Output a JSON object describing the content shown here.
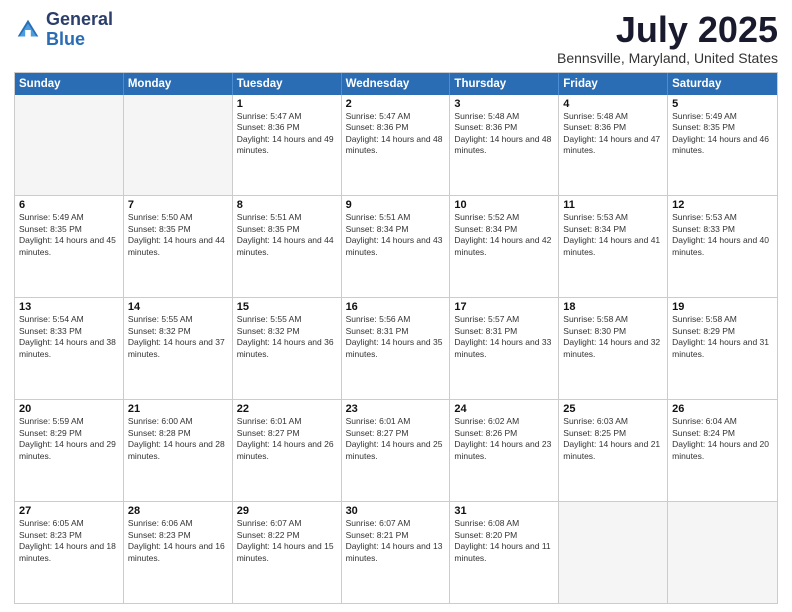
{
  "header": {
    "logo": {
      "general": "General",
      "blue": "Blue"
    },
    "title": "July 2025",
    "location": "Bennsville, Maryland, United States"
  },
  "days_of_week": [
    "Sunday",
    "Monday",
    "Tuesday",
    "Wednesday",
    "Thursday",
    "Friday",
    "Saturday"
  ],
  "weeks": [
    [
      {
        "day": null,
        "empty": true
      },
      {
        "day": null,
        "empty": true
      },
      {
        "day": "1",
        "sunrise": "5:47 AM",
        "sunset": "8:36 PM",
        "daylight": "14 hours and 49 minutes."
      },
      {
        "day": "2",
        "sunrise": "5:47 AM",
        "sunset": "8:36 PM",
        "daylight": "14 hours and 48 minutes."
      },
      {
        "day": "3",
        "sunrise": "5:48 AM",
        "sunset": "8:36 PM",
        "daylight": "14 hours and 48 minutes."
      },
      {
        "day": "4",
        "sunrise": "5:48 AM",
        "sunset": "8:36 PM",
        "daylight": "14 hours and 47 minutes."
      },
      {
        "day": "5",
        "sunrise": "5:49 AM",
        "sunset": "8:35 PM",
        "daylight": "14 hours and 46 minutes."
      }
    ],
    [
      {
        "day": "6",
        "sunrise": "5:49 AM",
        "sunset": "8:35 PM",
        "daylight": "14 hours and 45 minutes."
      },
      {
        "day": "7",
        "sunrise": "5:50 AM",
        "sunset": "8:35 PM",
        "daylight": "14 hours and 44 minutes."
      },
      {
        "day": "8",
        "sunrise": "5:51 AM",
        "sunset": "8:35 PM",
        "daylight": "14 hours and 44 minutes."
      },
      {
        "day": "9",
        "sunrise": "5:51 AM",
        "sunset": "8:34 PM",
        "daylight": "14 hours and 43 minutes."
      },
      {
        "day": "10",
        "sunrise": "5:52 AM",
        "sunset": "8:34 PM",
        "daylight": "14 hours and 42 minutes."
      },
      {
        "day": "11",
        "sunrise": "5:53 AM",
        "sunset": "8:34 PM",
        "daylight": "14 hours and 41 minutes."
      },
      {
        "day": "12",
        "sunrise": "5:53 AM",
        "sunset": "8:33 PM",
        "daylight": "14 hours and 40 minutes."
      }
    ],
    [
      {
        "day": "13",
        "sunrise": "5:54 AM",
        "sunset": "8:33 PM",
        "daylight": "14 hours and 38 minutes."
      },
      {
        "day": "14",
        "sunrise": "5:55 AM",
        "sunset": "8:32 PM",
        "daylight": "14 hours and 37 minutes."
      },
      {
        "day": "15",
        "sunrise": "5:55 AM",
        "sunset": "8:32 PM",
        "daylight": "14 hours and 36 minutes."
      },
      {
        "day": "16",
        "sunrise": "5:56 AM",
        "sunset": "8:31 PM",
        "daylight": "14 hours and 35 minutes."
      },
      {
        "day": "17",
        "sunrise": "5:57 AM",
        "sunset": "8:31 PM",
        "daylight": "14 hours and 33 minutes."
      },
      {
        "day": "18",
        "sunrise": "5:58 AM",
        "sunset": "8:30 PM",
        "daylight": "14 hours and 32 minutes."
      },
      {
        "day": "19",
        "sunrise": "5:58 AM",
        "sunset": "8:29 PM",
        "daylight": "14 hours and 31 minutes."
      }
    ],
    [
      {
        "day": "20",
        "sunrise": "5:59 AM",
        "sunset": "8:29 PM",
        "daylight": "14 hours and 29 minutes."
      },
      {
        "day": "21",
        "sunrise": "6:00 AM",
        "sunset": "8:28 PM",
        "daylight": "14 hours and 28 minutes."
      },
      {
        "day": "22",
        "sunrise": "6:01 AM",
        "sunset": "8:27 PM",
        "daylight": "14 hours and 26 minutes."
      },
      {
        "day": "23",
        "sunrise": "6:01 AM",
        "sunset": "8:27 PM",
        "daylight": "14 hours and 25 minutes."
      },
      {
        "day": "24",
        "sunrise": "6:02 AM",
        "sunset": "8:26 PM",
        "daylight": "14 hours and 23 minutes."
      },
      {
        "day": "25",
        "sunrise": "6:03 AM",
        "sunset": "8:25 PM",
        "daylight": "14 hours and 21 minutes."
      },
      {
        "day": "26",
        "sunrise": "6:04 AM",
        "sunset": "8:24 PM",
        "daylight": "14 hours and 20 minutes."
      }
    ],
    [
      {
        "day": "27",
        "sunrise": "6:05 AM",
        "sunset": "8:23 PM",
        "daylight": "14 hours and 18 minutes."
      },
      {
        "day": "28",
        "sunrise": "6:06 AM",
        "sunset": "8:23 PM",
        "daylight": "14 hours and 16 minutes."
      },
      {
        "day": "29",
        "sunrise": "6:07 AM",
        "sunset": "8:22 PM",
        "daylight": "14 hours and 15 minutes."
      },
      {
        "day": "30",
        "sunrise": "6:07 AM",
        "sunset": "8:21 PM",
        "daylight": "14 hours and 13 minutes."
      },
      {
        "day": "31",
        "sunrise": "6:08 AM",
        "sunset": "8:20 PM",
        "daylight": "14 hours and 11 minutes."
      },
      {
        "day": null,
        "empty": true
      },
      {
        "day": null,
        "empty": true
      }
    ]
  ]
}
